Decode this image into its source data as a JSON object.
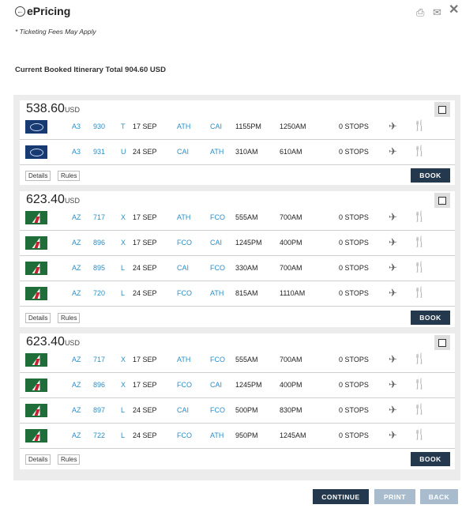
{
  "header": {
    "title": "ePricing",
    "back_icon": "back-circle-icon",
    "print_icon": "printer-icon",
    "mail_icon": "mail-icon",
    "close_icon": "close-icon"
  },
  "fees_note": "* Ticketing Fees May Apply",
  "itinerary_total": "Current Booked Itinerary Total 904.60 USD",
  "colors": {
    "accent": "#25394e",
    "link": "#2a8fc6",
    "disabled": "#a8bccd"
  },
  "options": [
    {
      "price": "538.60",
      "currency": "USD",
      "segments": [
        {
          "logo": "a3",
          "airline": "A3",
          "flight": "930",
          "cls": "T",
          "date": "17 SEP",
          "from": "ATH",
          "to": "CAI",
          "dep": "1155PM",
          "arr": "1250AM",
          "stops": "0  STOPS"
        },
        {
          "logo": "a3",
          "airline": "A3",
          "flight": "931",
          "cls": "U",
          "date": "24 SEP",
          "from": "CAI",
          "to": "ATH",
          "dep": "310AM",
          "arr": "610AM",
          "stops": "0  STOPS"
        }
      ]
    },
    {
      "price": "623.40",
      "currency": "USD",
      "segments": [
        {
          "logo": "az",
          "airline": "AZ",
          "flight": "717",
          "cls": "X",
          "date": "17 SEP",
          "from": "ATH",
          "to": "FCO",
          "dep": "555AM",
          "arr": "700AM",
          "stops": "0  STOPS"
        },
        {
          "logo": "az",
          "airline": "AZ",
          "flight": "896",
          "cls": "X",
          "date": "17 SEP",
          "from": "FCO",
          "to": "CAI",
          "dep": "1245PM",
          "arr": "400PM",
          "stops": "0  STOPS"
        },
        {
          "logo": "az",
          "airline": "AZ",
          "flight": "895",
          "cls": "L",
          "date": "24 SEP",
          "from": "CAI",
          "to": "FCO",
          "dep": "330AM",
          "arr": "700AM",
          "stops": "0  STOPS"
        },
        {
          "logo": "az",
          "airline": "AZ",
          "flight": "720",
          "cls": "L",
          "date": "24 SEP",
          "from": "FCO",
          "to": "ATH",
          "dep": "815AM",
          "arr": "1110AM",
          "stops": "0  STOPS"
        }
      ]
    },
    {
      "price": "623.40",
      "currency": "USD",
      "segments": [
        {
          "logo": "az",
          "airline": "AZ",
          "flight": "717",
          "cls": "X",
          "date": "17 SEP",
          "from": "ATH",
          "to": "FCO",
          "dep": "555AM",
          "arr": "700AM",
          "stops": "0  STOPS"
        },
        {
          "logo": "az",
          "airline": "AZ",
          "flight": "896",
          "cls": "X",
          "date": "17 SEP",
          "from": "FCO",
          "to": "CAI",
          "dep": "1245PM",
          "arr": "400PM",
          "stops": "0  STOPS"
        },
        {
          "logo": "az",
          "airline": "AZ",
          "flight": "897",
          "cls": "L",
          "date": "24 SEP",
          "from": "CAI",
          "to": "FCO",
          "dep": "500PM",
          "arr": "830PM",
          "stops": "0  STOPS"
        },
        {
          "logo": "az",
          "airline": "AZ",
          "flight": "722",
          "cls": "L",
          "date": "24 SEP",
          "from": "FCO",
          "to": "ATH",
          "dep": "950PM",
          "arr": "1245AM",
          "stops": "0  STOPS"
        }
      ]
    }
  ],
  "card_buttons": {
    "details": "Details",
    "rules": "Rules",
    "book": "BOOK"
  },
  "footer": {
    "continue": "CONTINUE",
    "print": "PRINT",
    "back": "BACK"
  }
}
